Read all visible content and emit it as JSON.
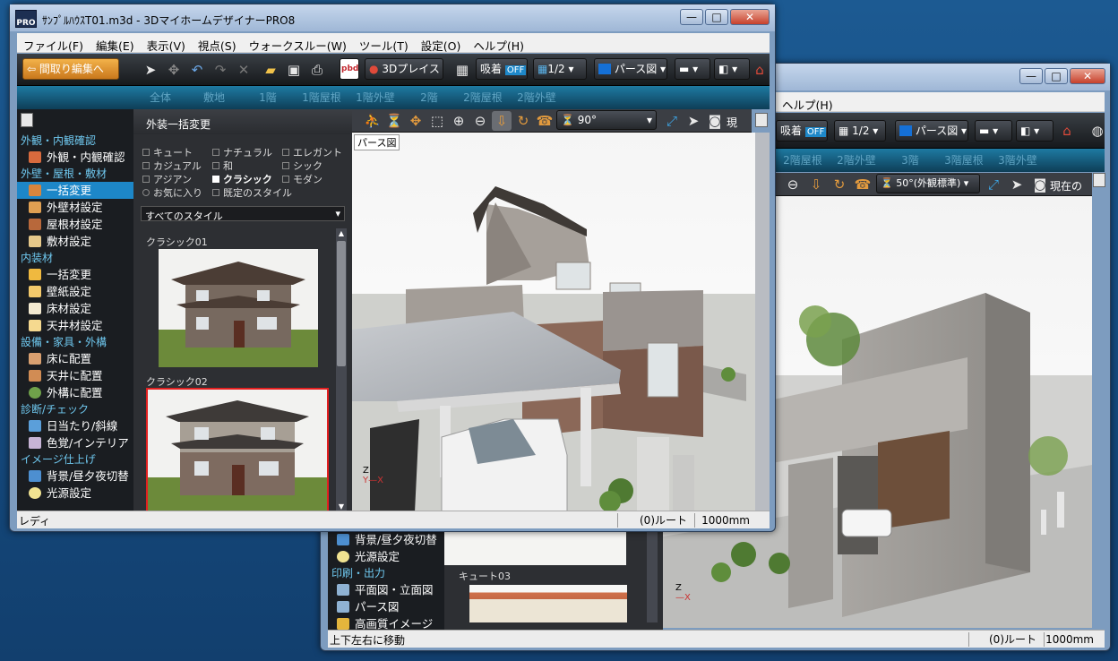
{
  "back_window": {
    "menu": {
      "help": "ヘルプ(H)"
    },
    "toolbar": {
      "snap_label": "吸着",
      "snap_state": "OFF",
      "grid_label": "1/2",
      "view_mode": "パース図"
    },
    "subtabs": [
      "2階屋根",
      "2階外壁",
      "3階",
      "3階屋根",
      "3階外壁"
    ],
    "view_toolbar": {
      "lens": "50°(外観標準)",
      "current": "現在の"
    },
    "sidebar_items": [
      {
        "type": "item",
        "label": "背景/昼夕夜切替"
      },
      {
        "type": "item",
        "label": "光源設定"
      },
      {
        "type": "head",
        "label": "印刷・出力"
      },
      {
        "type": "item",
        "label": "平面図・立面図"
      },
      {
        "type": "item",
        "label": "パース図"
      },
      {
        "type": "item",
        "label": "高画質イメージ"
      }
    ],
    "thumb_label": "キュート03",
    "status": {
      "left": "上下左右に移動",
      "route": "(0)ルート",
      "unit": "1000mm"
    }
  },
  "front_window": {
    "title": "ｻﾝﾌﾟﾙﾊｳｽT01.m3d - 3DマイホームデザイナーPRO8",
    "logo_text": "PRO",
    "window_buttons": {
      "minimize": "—",
      "maximize": "□",
      "close": "✕"
    },
    "menu": [
      "ファイル(F)",
      "編集(E)",
      "表示(V)",
      "視点(S)",
      "ウォークスルー(W)",
      "ツール(T)",
      "設定(O)",
      "ヘルプ(H)"
    ],
    "toolbar": {
      "edit_floorplan": "間取り編集へ",
      "pbd": "pbd",
      "threed_place": "3Dプレイス",
      "snap_label": "吸着",
      "snap_state": "OFF",
      "grid_label": "1/2",
      "view_mode": "パース図"
    },
    "subtabs": [
      "全体",
      "敷地",
      "1階",
      "1階屋根",
      "1階外壁",
      "2階",
      "2階屋根",
      "2階外壁"
    ],
    "sidebar": [
      {
        "type": "head",
        "label": "外観・内観確認"
      },
      {
        "type": "item",
        "label": "外観・内観確認"
      },
      {
        "type": "head",
        "label": "外壁・屋根・敷材"
      },
      {
        "type": "item",
        "label": "一括変更",
        "selected": true
      },
      {
        "type": "item",
        "label": "外壁材設定"
      },
      {
        "type": "item",
        "label": "屋根材設定"
      },
      {
        "type": "item",
        "label": "敷材設定"
      },
      {
        "type": "head",
        "label": "内装材"
      },
      {
        "type": "item",
        "label": "一括変更"
      },
      {
        "type": "item",
        "label": "壁紙設定"
      },
      {
        "type": "item",
        "label": "床材設定"
      },
      {
        "type": "item",
        "label": "天井材設定"
      },
      {
        "type": "head",
        "label": "設備・家具・外構"
      },
      {
        "type": "item",
        "label": "床に配置"
      },
      {
        "type": "item",
        "label": "天井に配置"
      },
      {
        "type": "item",
        "label": "外構に配置"
      },
      {
        "type": "head",
        "label": "診断/チェック"
      },
      {
        "type": "item",
        "label": "日当たり/斜線"
      },
      {
        "type": "item",
        "label": "色覚/インテリア"
      },
      {
        "type": "head",
        "label": "イメージ仕上げ"
      },
      {
        "type": "item",
        "label": "背景/昼夕夜切替"
      },
      {
        "type": "item",
        "label": "光源設定"
      }
    ],
    "style_panel": {
      "title": "外装一括変更",
      "options": [
        "キュート",
        "ナチュラル",
        "エレガント",
        "カジュアル",
        "和",
        "シック",
        "アジアン",
        "クラシック",
        "モダン",
        "お気に入り",
        "既定のスタイル"
      ],
      "dropdown": "すべてのスタイル",
      "thumbs": [
        "クラシック01",
        "クラシック02"
      ]
    },
    "view_toolbar": {
      "lens": "90°",
      "extra": "現"
    },
    "view_label": "パース図",
    "axes": {
      "z": "Z",
      "y": "Y",
      "x": "X"
    },
    "status": {
      "left": "レディ",
      "route": "(0)ルート",
      "unit": "1000mm"
    }
  }
}
